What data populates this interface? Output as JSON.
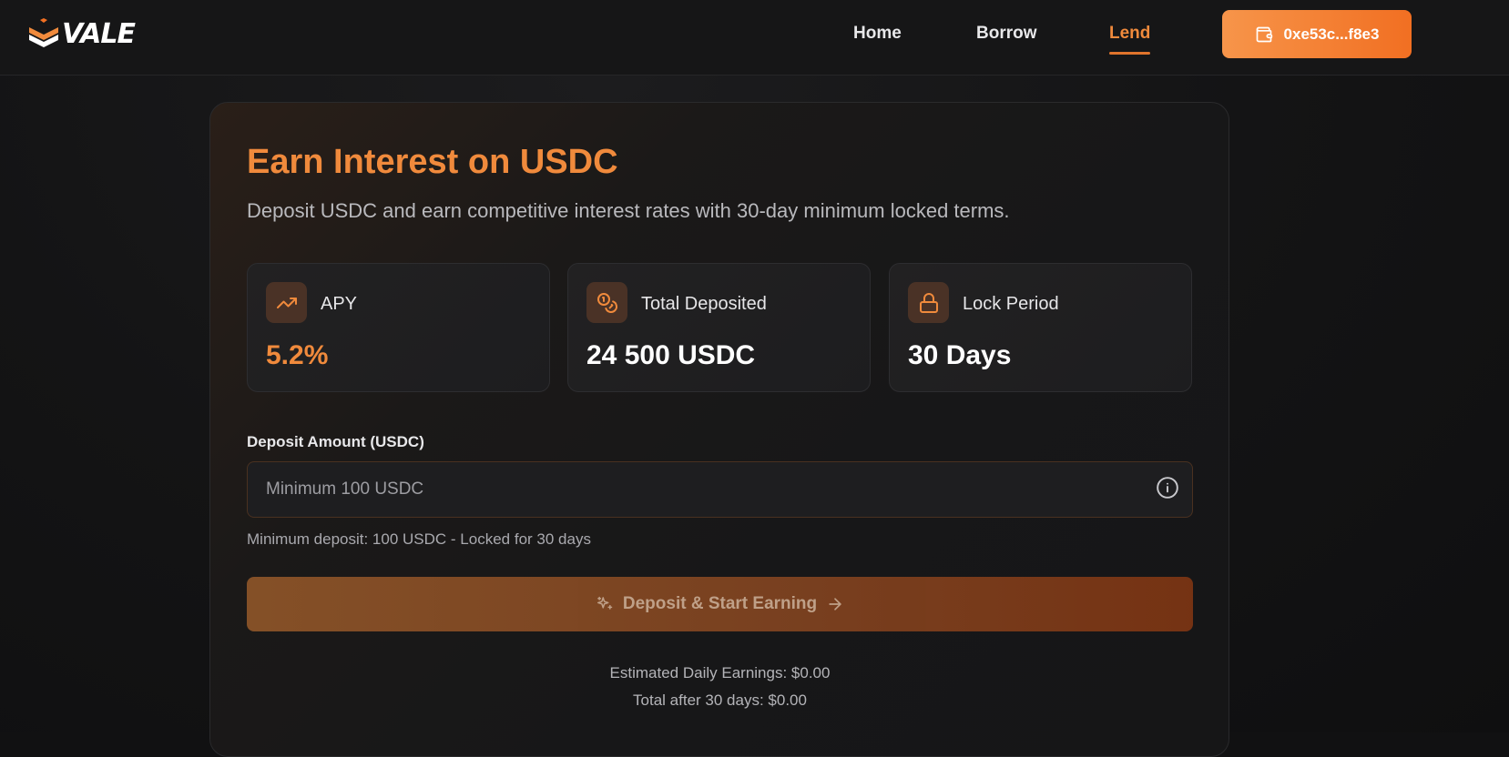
{
  "brand": {
    "name": "VALE",
    "logo_icon": "vale-chevron-logo",
    "accent": "#f08a3c"
  },
  "nav": {
    "items": [
      {
        "label": "Home",
        "active": false
      },
      {
        "label": "Borrow",
        "active": false
      },
      {
        "label": "Lend",
        "active": true
      }
    ]
  },
  "wallet": {
    "address": "0xe53c...f8e3",
    "icon": "wallet-icon"
  },
  "main": {
    "title": "Earn Interest on USDC",
    "subtitle": "Deposit USDC and earn competitive interest rates with 30-day minimum locked terms.",
    "stats": [
      {
        "label": "APY",
        "value": "5.2%",
        "icon": "trending-up-icon"
      },
      {
        "label": "Total Deposited",
        "value": "24 500 USDC",
        "icon": "coins-icon"
      },
      {
        "label": "Lock Period",
        "value": "30 Days",
        "icon": "lock-icon"
      }
    ],
    "deposit": {
      "label": "Deposit Amount (USDC)",
      "value": "",
      "placeholder": "Minimum 100 USDC",
      "helper": "Minimum deposit: 100 USDC - Locked for 30 days",
      "button_label": "Deposit & Start Earning"
    },
    "estimates": {
      "daily": "Estimated Daily Earnings: $0.00",
      "total": "Total after 30 days: $0.00"
    }
  }
}
